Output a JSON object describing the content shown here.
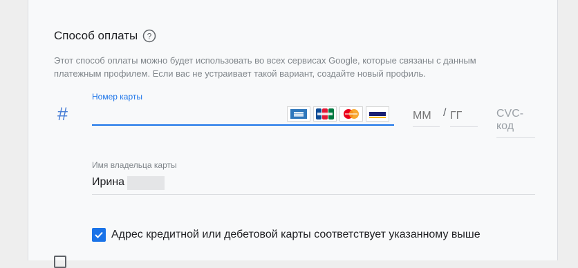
{
  "payment": {
    "title": "Способ оплаты",
    "description": "Этот способ оплаты можно будет использовать во всех сервисах Google, которые связаны с данным платежным профилем. Если вас не устраивает такой вариант, создайте новый профиль.",
    "card_label": "Номер карты",
    "card_value": "",
    "hash_symbol": "#",
    "card_brands": [
      "American Express",
      "JCB",
      "MasterCard",
      "VISA"
    ],
    "expiry": {
      "month_placeholder": "ММ",
      "slash": "/",
      "year_placeholder": "ГГ"
    },
    "cvc_placeholder": "CVC-код",
    "name_label": "Имя владельца карты",
    "name_value": "Ирина",
    "address_checkbox": {
      "label": "Адрес кредитной или дебетовой карты соответствует указанному выше",
      "checked": true
    }
  },
  "colors": {
    "accent": "#1a73e8",
    "hash_icon": "#4a7fd6",
    "panel_bg": "#f8f9fa",
    "page_bg": "#eeeeee"
  }
}
